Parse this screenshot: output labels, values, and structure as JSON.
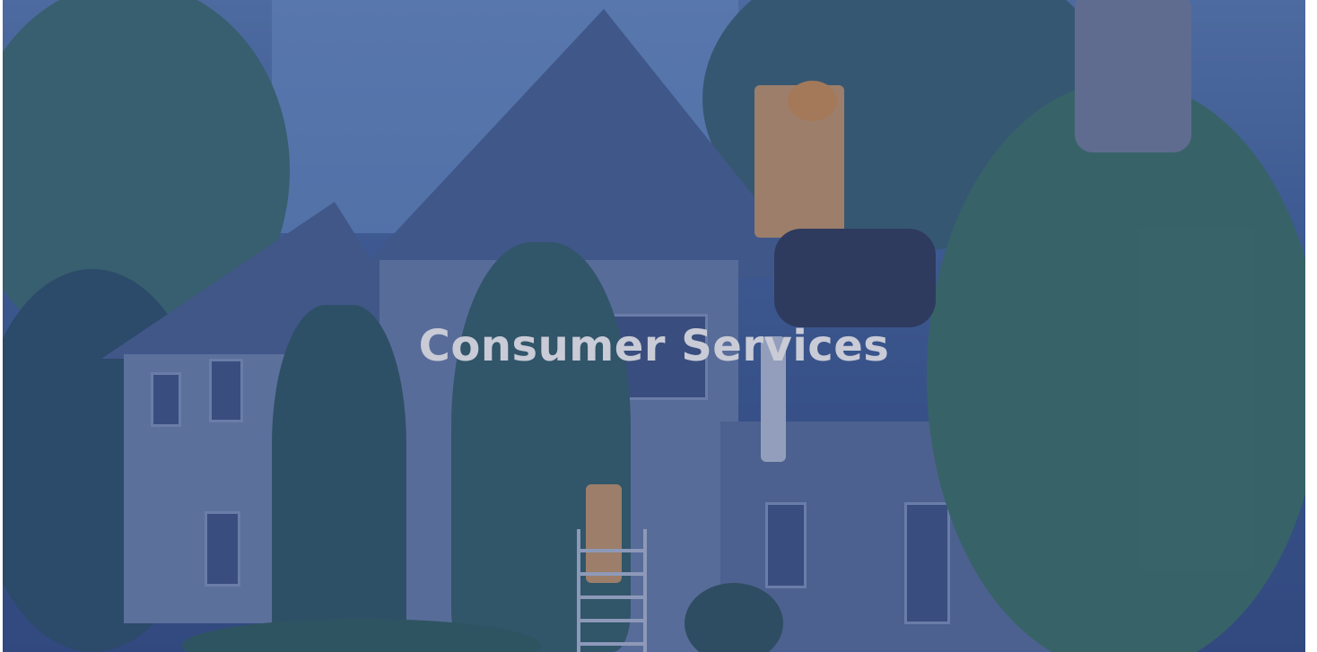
{
  "hero": {
    "title": "Consumer Services",
    "overlay_color": "#2e4a8a"
  }
}
